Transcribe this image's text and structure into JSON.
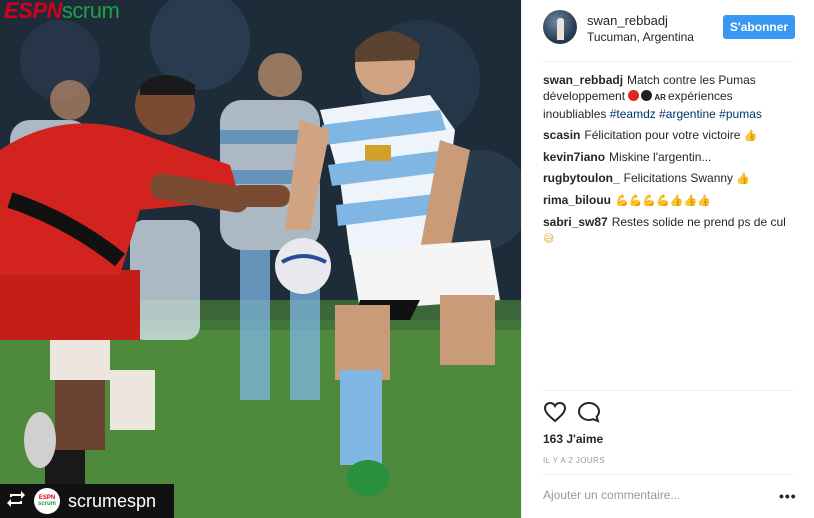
{
  "photo": {
    "brand_part1": "ESPN",
    "brand_part2": "scrum",
    "repost_icon": "repost-icon",
    "repost_logo_top": "ESPN",
    "repost_logo_bottom": "scrum",
    "repost_account": "scrumespn",
    "jersey_red": "#d2231f",
    "jersey_sky": "#7fb6e4"
  },
  "header": {
    "username": "swan_rebbadj",
    "location": "Tucuman, Argentina",
    "follow_label": "S'abonner"
  },
  "caption": {
    "user": "swan_rebbadj",
    "text_a": "Match contre les Pumas développement",
    "flag": "AR",
    "text_b": "expériences inoubliables",
    "tags": [
      "#teamdz",
      "#argentine",
      "#pumas"
    ]
  },
  "comments": [
    {
      "user": "scasin",
      "text": "Félicitation pour votre victoire",
      "emoji": "👍"
    },
    {
      "user": "kevin7iano",
      "text": "Miskine l'argentin...",
      "emoji": ""
    },
    {
      "user": "rugbytoulon_",
      "text": "Felicitations Swanny",
      "emoji": "👍"
    },
    {
      "user": "rima_bilouu",
      "text": "",
      "emoji": "💪💪💪💪👍👍👍"
    },
    {
      "user": "sabri_sw87",
      "text": "Restes solide ne prend ps de cul",
      "emoji": "😅"
    }
  ],
  "actions": {
    "heart_icon": "heart-icon",
    "comment_icon": "comment-icon",
    "likes": "163 J'aime",
    "time": "IL Y A 2 JOURS"
  },
  "compose": {
    "placeholder": "Ajouter un commentaire...",
    "more_label": "•••"
  }
}
